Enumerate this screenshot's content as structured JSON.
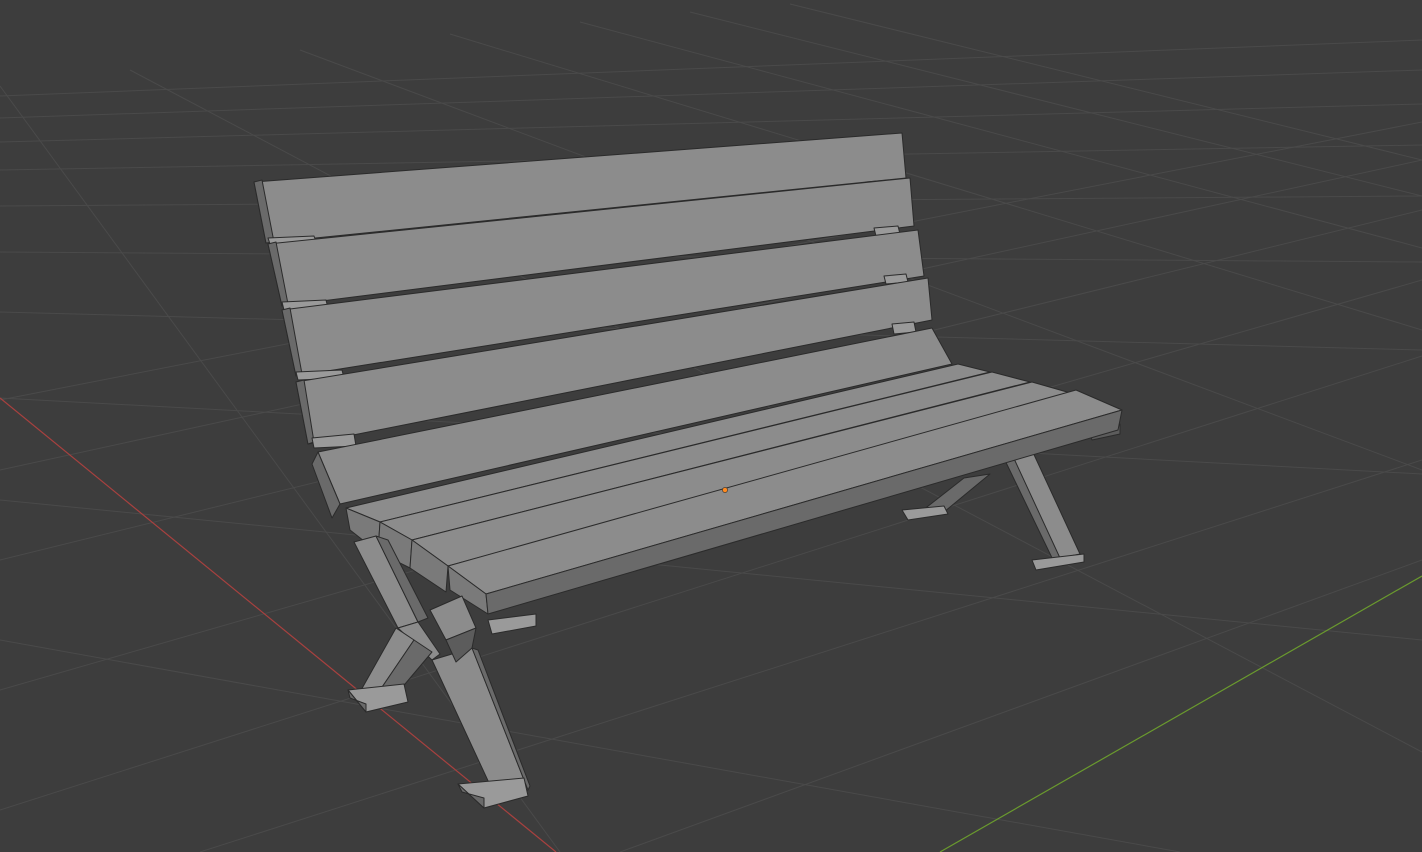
{
  "viewport": {
    "background_color": "#3d3d3d",
    "grid_color": "#4a4a4a",
    "x_axis_color": "#a8413f",
    "y_axis_color": "#6a9a2e",
    "origin_color": "#ff8a1f"
  },
  "scene": {
    "object": "bench",
    "object_face_color": "#8c8c8c",
    "object_wire_color": "#2b2b2b"
  }
}
